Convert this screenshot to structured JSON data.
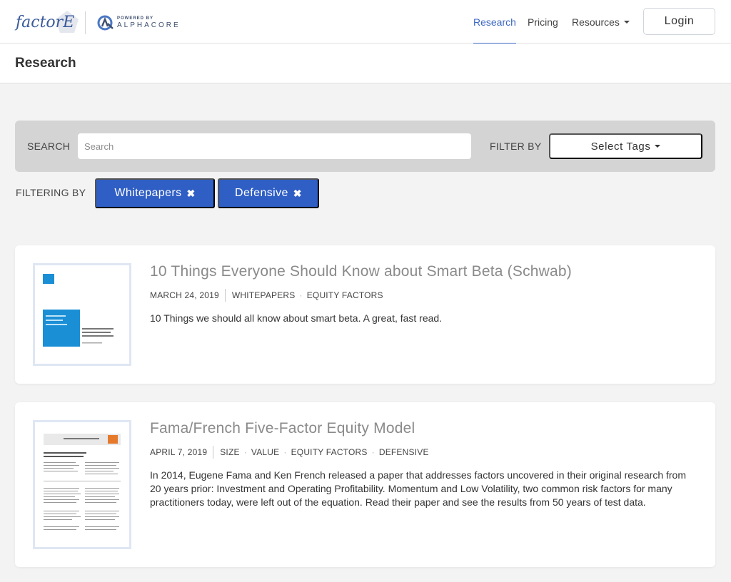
{
  "header": {
    "brand": "factorE",
    "powered_small": "POWERED BY",
    "powered_big": "ALPHACORE",
    "nav": {
      "research": "Research",
      "pricing": "Pricing",
      "resources": "Resources"
    },
    "login_label": "Login",
    "accent": "#3b67c3"
  },
  "page": {
    "title": "Research"
  },
  "search": {
    "label": "SEARCH",
    "placeholder": "Search",
    "value": "",
    "filter_label": "FILTER BY",
    "tags_button": "Select Tags"
  },
  "filters": {
    "label": "FILTERING BY",
    "chips": [
      {
        "label": "Whitepapers"
      },
      {
        "label": "Defensive"
      }
    ],
    "chip_color": "#2f5ec4"
  },
  "articles": [
    {
      "title": "10 Things Everyone Should Know about Smart Beta (Schwab)",
      "date": "MARCH 24, 2019",
      "tags": [
        "WHITEPAPERS",
        "EQUITY FACTORS"
      ],
      "description": "10 Things we should all know about smart beta. A great, fast read.",
      "thumbnail_icon": "document-cover-icon"
    },
    {
      "title": "Fama/French Five-Factor Equity Model",
      "date": "APRIL 7, 2019",
      "tags": [
        "SIZE",
        "VALUE",
        "EQUITY FACTORS",
        "DEFENSIVE"
      ],
      "description": "In 2014, Eugene Fama and Ken French released a paper that addresses factors uncovered in their original research from 20 years prior: Investment and Operating Profitability. Momentum and Low Volatility, two common risk factors for many practitioners today, were left out of the equation. Read their paper and see the results from 50 years of test data.",
      "thumbnail_icon": "paper-page-icon"
    }
  ]
}
